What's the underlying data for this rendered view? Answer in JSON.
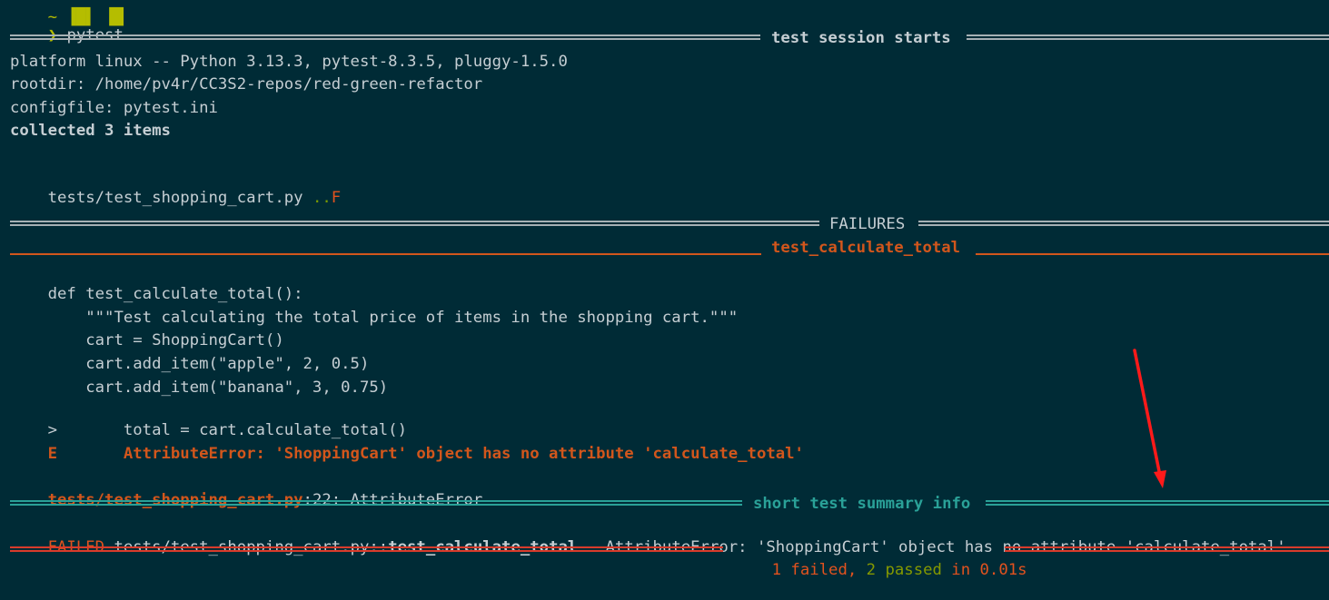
{
  "terminal": {
    "prompt_symbol": "❯",
    "command": "pytest",
    "session_header": "test session starts",
    "platform_line": "platform linux -- Python 3.13.3, pytest-8.3.5, pluggy-1.5.0",
    "rootdir_line": "rootdir: /home/pv4r/CC3S2-repos/red-green-refactor",
    "configfile_line": "configfile: pytest.ini",
    "collected_line": "collected 3 items",
    "test_file": "tests/test_shopping_cart.py",
    "progress_pass": "..",
    "progress_fail": "F",
    "failures_header": "FAILURES",
    "failed_test_header": "test_calculate_total",
    "code_lines": [
      "    def test_calculate_total():",
      "        \"\"\"Test calculating the total price of items in the shopping cart.\"\"\"",
      "        cart = ShoppingCart()",
      "        cart.add_item(\"apple\", 2, 0.5)",
      "        cart.add_item(\"banana\", 3, 0.75)"
    ],
    "pointer_marker": ">",
    "pointer_line": "       total = cart.calculate_total()",
    "error_marker": "E",
    "error_line": "       AttributeError: 'ShoppingCart' object has no attribute 'calculate_total'",
    "location_file": "tests/test_shopping_cart.py",
    "location_rest": ":22: AttributeError",
    "summary_header": "short test summary info",
    "summary_failed_label": "FAILED",
    "summary_path": "tests/test_shopping_cart.py",
    "summary_sep": "::",
    "summary_test": "test_calculate_total",
    "summary_message": " - AttributeError: 'ShoppingCart' object has no attribute 'calculate_total'",
    "result_failed": "1 failed",
    "result_comma": ", ",
    "result_passed": "2 passed",
    "result_time": " in 0.01s"
  },
  "colors": {
    "background": "#002b36",
    "annotation_arrow": "#ff1a1a"
  }
}
